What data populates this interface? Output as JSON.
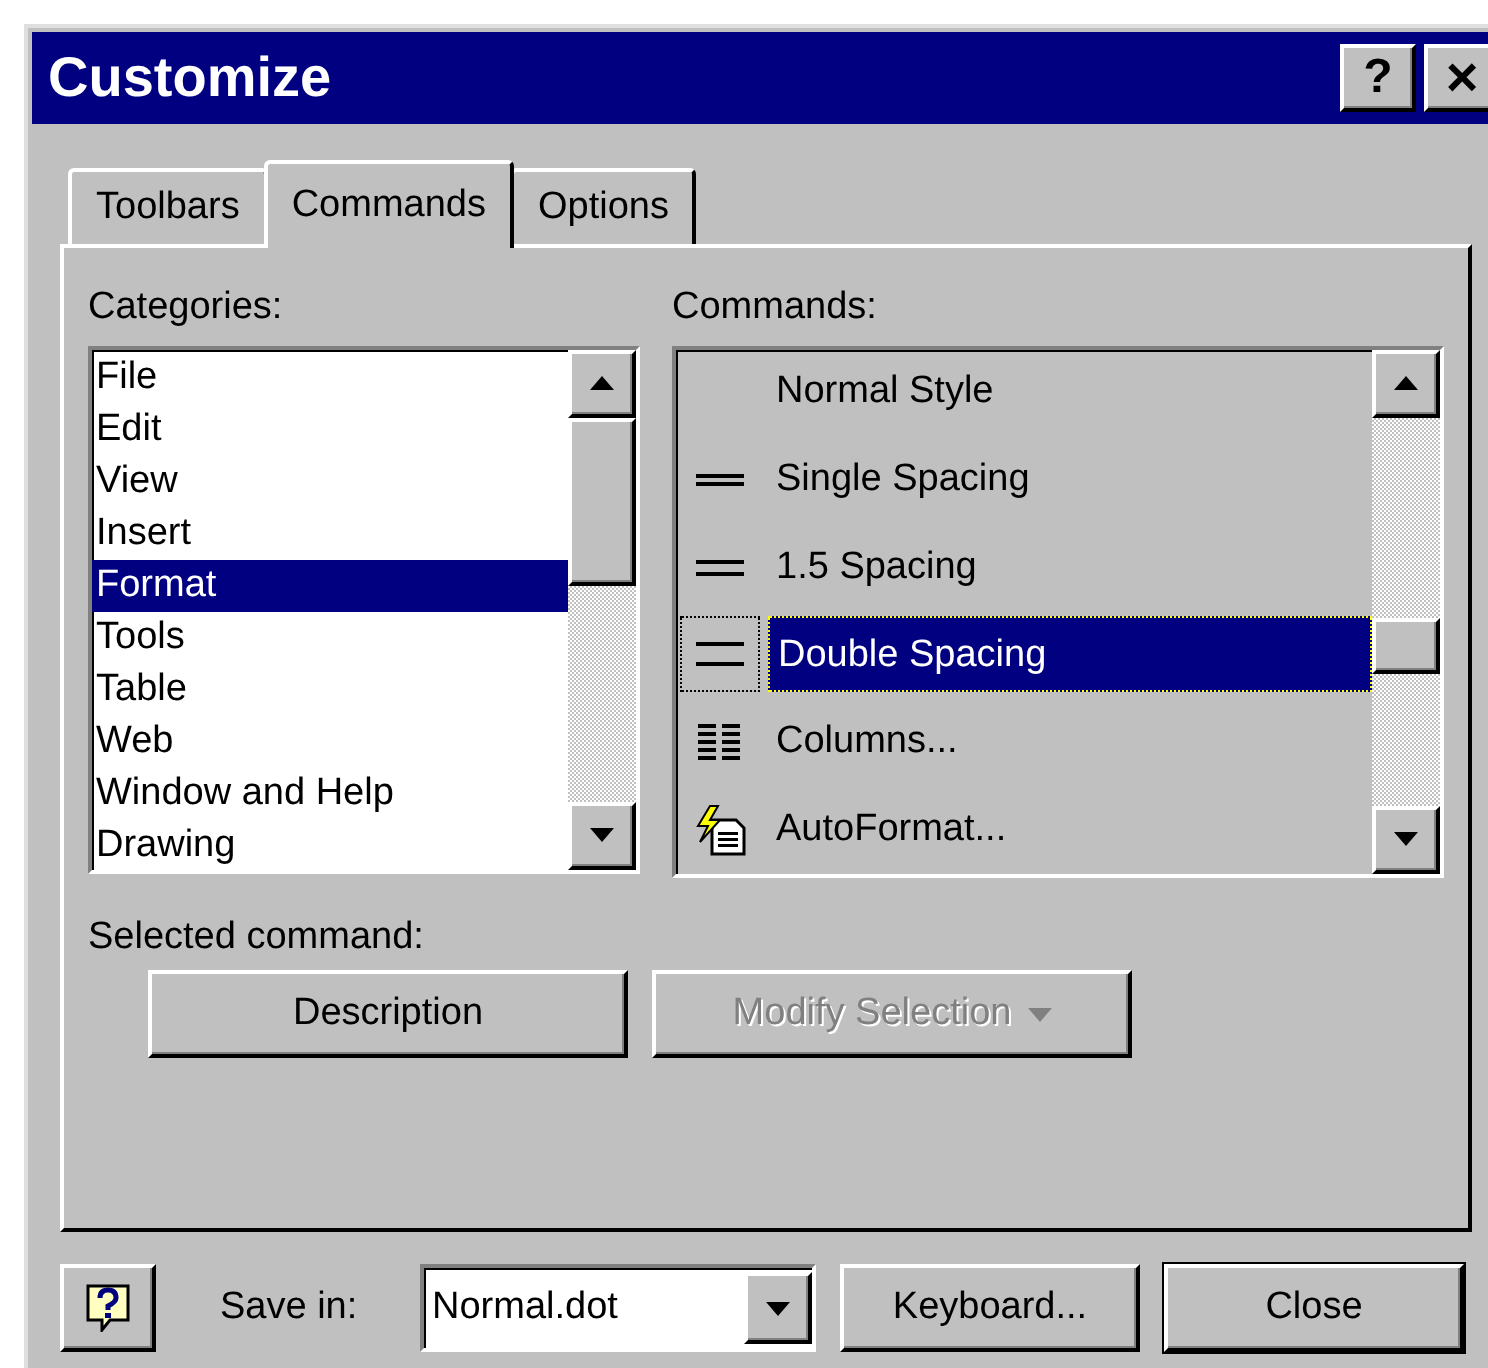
{
  "window": {
    "title": "Customize",
    "help_button": "?",
    "close_button": "×"
  },
  "tabs": [
    {
      "label": "Toolbars",
      "selected": false
    },
    {
      "label": "Commands",
      "selected": true
    },
    {
      "label": "Options",
      "selected": false
    }
  ],
  "categories": {
    "label": "Categories:",
    "items": [
      {
        "label": "File",
        "selected": false
      },
      {
        "label": "Edit",
        "selected": false
      },
      {
        "label": "View",
        "selected": false
      },
      {
        "label": "Insert",
        "selected": false
      },
      {
        "label": "Format",
        "selected": true
      },
      {
        "label": "Tools",
        "selected": false
      },
      {
        "label": "Table",
        "selected": false
      },
      {
        "label": "Web",
        "selected": false
      },
      {
        "label": "Window and Help",
        "selected": false
      },
      {
        "label": "Drawing",
        "selected": false
      }
    ]
  },
  "commands": {
    "label": "Commands:",
    "items": [
      {
        "label": "Normal Style",
        "kind": "none",
        "selected": false
      },
      {
        "label": "Single Spacing",
        "kind": "single",
        "selected": false
      },
      {
        "label": "1.5 Spacing",
        "kind": "onehalf",
        "selected": false
      },
      {
        "label": "Double Spacing",
        "kind": "double",
        "selected": true
      },
      {
        "label": "Columns...",
        "kind": "columns",
        "selected": false
      },
      {
        "label": "AutoFormat...",
        "kind": "autoformat",
        "selected": false
      }
    ]
  },
  "selected_command": {
    "label": "Selected command:",
    "buttons": [
      {
        "label": "Description",
        "disabled": false
      },
      {
        "label": "Modify Selection",
        "disabled": true
      }
    ]
  },
  "footer": {
    "save_in_label": "Save in:",
    "save_in_value": "Normal.dot",
    "buttons": [
      "Keyboard...",
      "Close"
    ]
  }
}
